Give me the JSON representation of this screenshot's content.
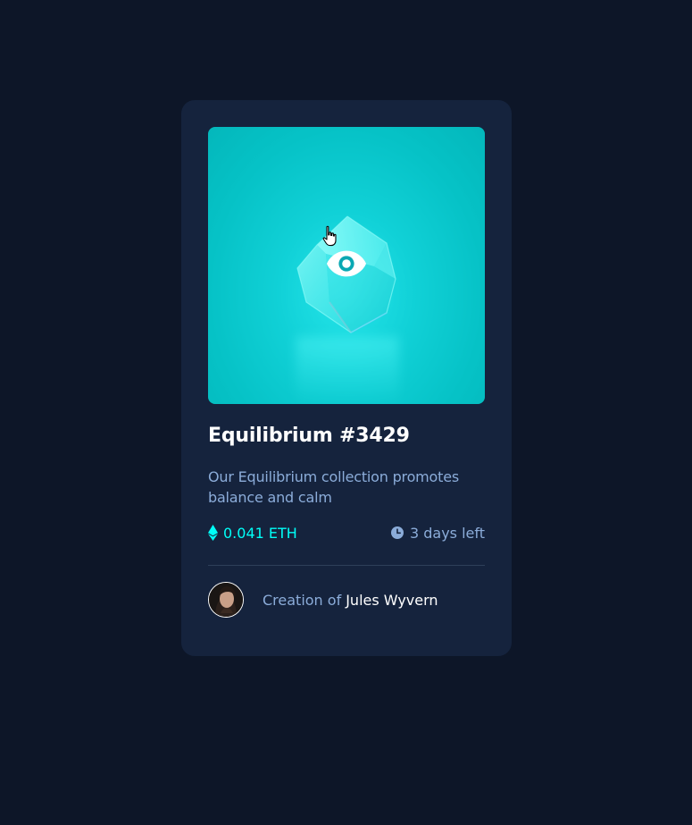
{
  "card": {
    "title": "Equilibrium #3429",
    "description": "Our Equilibrium collection promotes balance and calm",
    "price": "0.041 ETH",
    "time_left": "3 days left",
    "creator_prefix": "Creation of",
    "creator_name": "Jules Wyvern"
  },
  "icons": {
    "view": "eye-icon",
    "price": "ethereum-icon",
    "time": "clock-icon",
    "cursor": "hand-pointer-icon"
  },
  "colors": {
    "background": "#0d1628",
    "card": "#15233d",
    "accent": "#00fff8",
    "muted": "#8bacd9",
    "divider": "#2e405a",
    "white": "#ffffff"
  }
}
